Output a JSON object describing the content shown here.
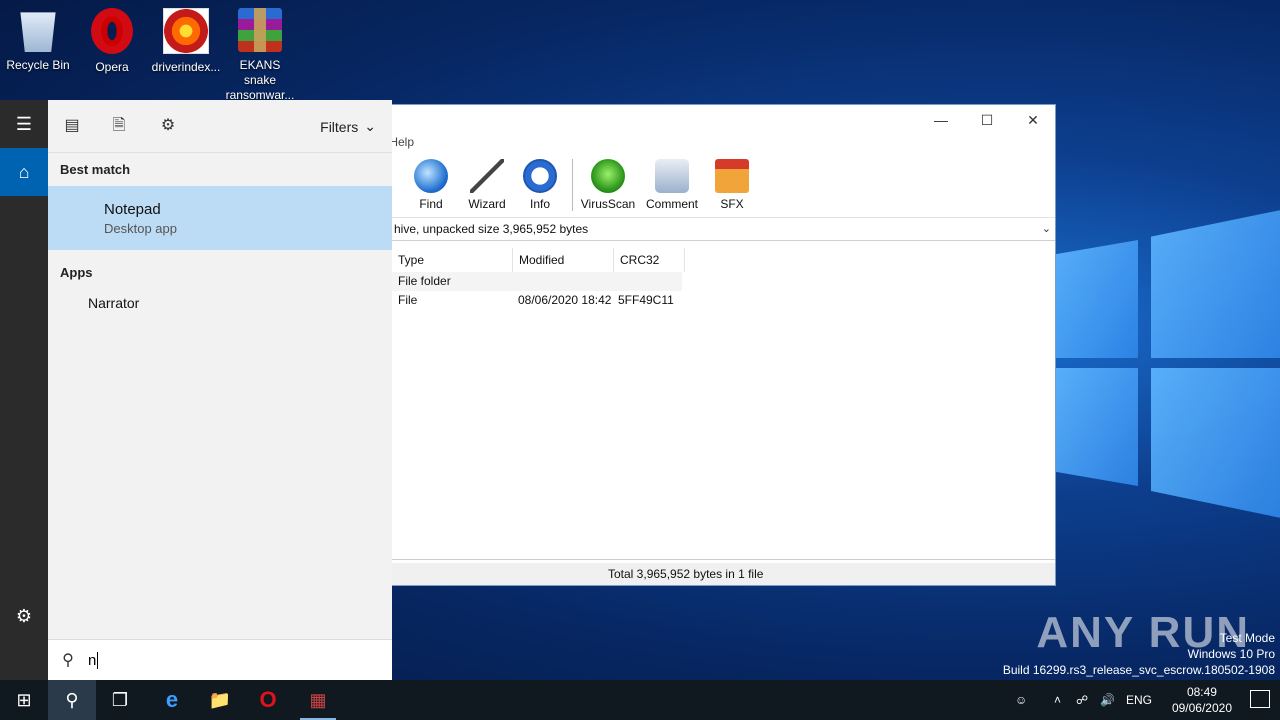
{
  "desktop": {
    "icons": [
      {
        "label": "Recycle Bin"
      },
      {
        "label": "Opera"
      },
      {
        "label": "driverindex..."
      },
      {
        "label": "EKANS snake ransomwar..."
      }
    ],
    "watermark": "ANY RUN",
    "test_mode": [
      "Test Mode",
      "Windows 10 Pro",
      "Build 16299.rs3_release_svc_escrow.180502-1908"
    ]
  },
  "start": {
    "filters_label": "Filters",
    "best_match_title": "Best match",
    "best_match": {
      "name": "Notepad",
      "subtitle": "Desktop app"
    },
    "apps_title": "Apps",
    "apps": [
      "Narrator"
    ],
    "search_text": "n"
  },
  "winrar": {
    "menu_partial": "Help",
    "tools": [
      "Find",
      "Wizard",
      "Info",
      "VirusScan",
      "Comment",
      "SFX"
    ],
    "path_text": "hive, unpacked size 3,965,952 bytes",
    "columns": [
      "Type",
      "Modified",
      "CRC32"
    ],
    "rows": [
      {
        "type": "File folder",
        "modified": "",
        "crc": ""
      },
      {
        "type": "File",
        "modified": "08/06/2020 18:42",
        "crc": "5FF49C11"
      }
    ],
    "status": "Total 3,965,952 bytes in 1 file"
  },
  "taskbar": {
    "language": "ENG",
    "time": "08:49",
    "date": "09/06/2020"
  }
}
